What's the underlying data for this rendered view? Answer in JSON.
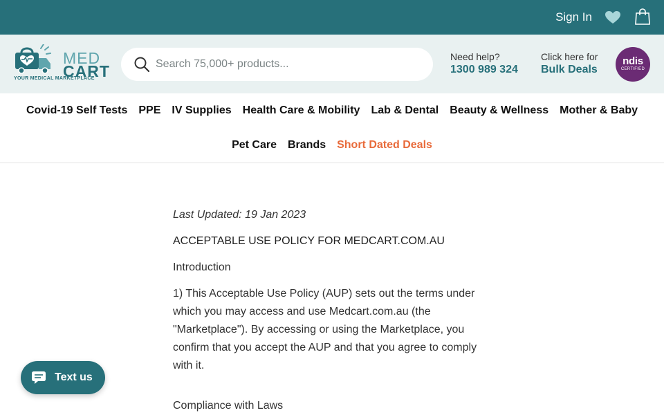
{
  "topbar": {
    "signin_label": "Sign In",
    "wishlist_icon": "heart-icon",
    "cart_icon": "shopping-bag-icon",
    "background": "#27707a"
  },
  "header": {
    "logo": {
      "word1": "MED",
      "word2": "CART",
      "tagline": "YOUR MEDICAL MARKETPLACE"
    },
    "search": {
      "placeholder": "Search 75,000+ products...",
      "value": ""
    },
    "help": {
      "line1": "Need help?",
      "phone": "1300 989 324"
    },
    "bulk": {
      "line1": "Click here for",
      "link": "Bulk Deals"
    },
    "ndis": {
      "brand": "ndis",
      "sub": "CERTIFIED"
    }
  },
  "nav": {
    "row1": [
      "Covid-19 Self Tests",
      "PPE",
      "IV Supplies",
      "Health Care & Mobility",
      "Lab & Dental",
      "Beauty & Wellness",
      "Mother & Baby"
    ],
    "row2": [
      "Pet Care",
      "Brands",
      "Short Dated Deals"
    ],
    "deal_color": "#e86a3a"
  },
  "content": {
    "updated": "Last Updated: 19 Jan 2023",
    "title": "ACCEPTABLE USE POLICY FOR MEDCART.COM.AU",
    "intro_heading": "Introduction",
    "para1": "1) This Acceptable Use Policy (AUP) sets out the terms under which you may access and use Medcart.com.au (the \"Marketplace\"). By accessing or using the Marketplace, you confirm that you accept the AUP and that you agree to comply with it.",
    "compliance_heading": "Compliance with Laws"
  },
  "textus": {
    "label": "Text us",
    "icon": "chat-bubble-icon"
  }
}
